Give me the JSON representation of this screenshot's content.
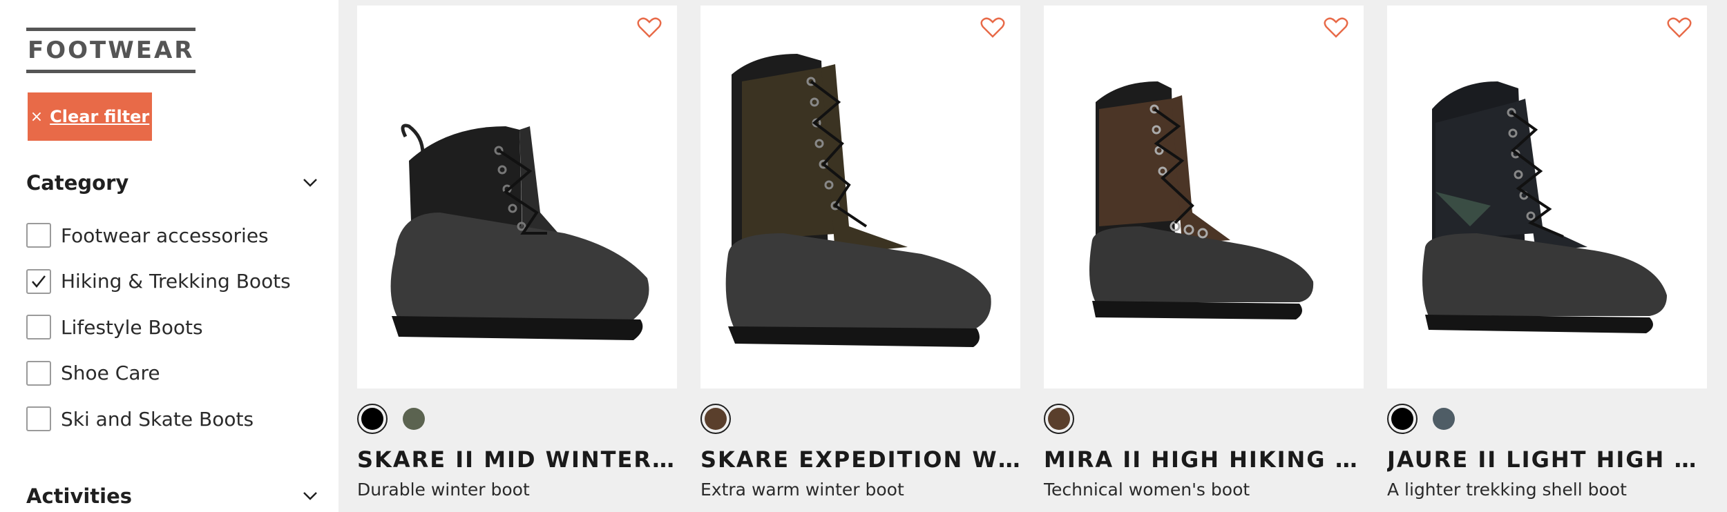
{
  "sidebar": {
    "brand_title": "FOOTWEAR",
    "clear_filter_label": "Clear filter",
    "clear_filter_icon": "×",
    "category": {
      "title": "Category",
      "items": [
        {
          "label": "Footwear accessories",
          "checked": false
        },
        {
          "label": "Hiking & Trekking Boots",
          "checked": true
        },
        {
          "label": "Lifestyle Boots",
          "checked": false
        },
        {
          "label": "Shoe Care",
          "checked": false
        },
        {
          "label": "Ski and Skate Boots",
          "checked": false
        }
      ]
    },
    "activities": {
      "title": "Activities"
    }
  },
  "products": [
    {
      "name": "SKARE II MID WINTER BOOTS MEN",
      "description": "Durable winter boot",
      "swatches": [
        "#000000",
        "#5b6350"
      ]
    },
    {
      "name": "SKARE EXPEDITION WINTER BOOTS",
      "description": "Extra warm winter boot",
      "swatches": [
        "#5a3f2c"
      ]
    },
    {
      "name": "MIRA II HIGH HIKING BOOTS WOMEN",
      "description": "Technical women's boot",
      "swatches": [
        "#5a3f2c"
      ]
    },
    {
      "name": "JAURE II LIGHT HIGH HIKING BOOTS",
      "description": "A lighter trekking shell boot",
      "swatches": [
        "#000000",
        "#4f5d66"
      ]
    }
  ],
  "colors": {
    "accent": "#e86a48",
    "heart": "#e86a48",
    "grid_background": "#efefef"
  }
}
